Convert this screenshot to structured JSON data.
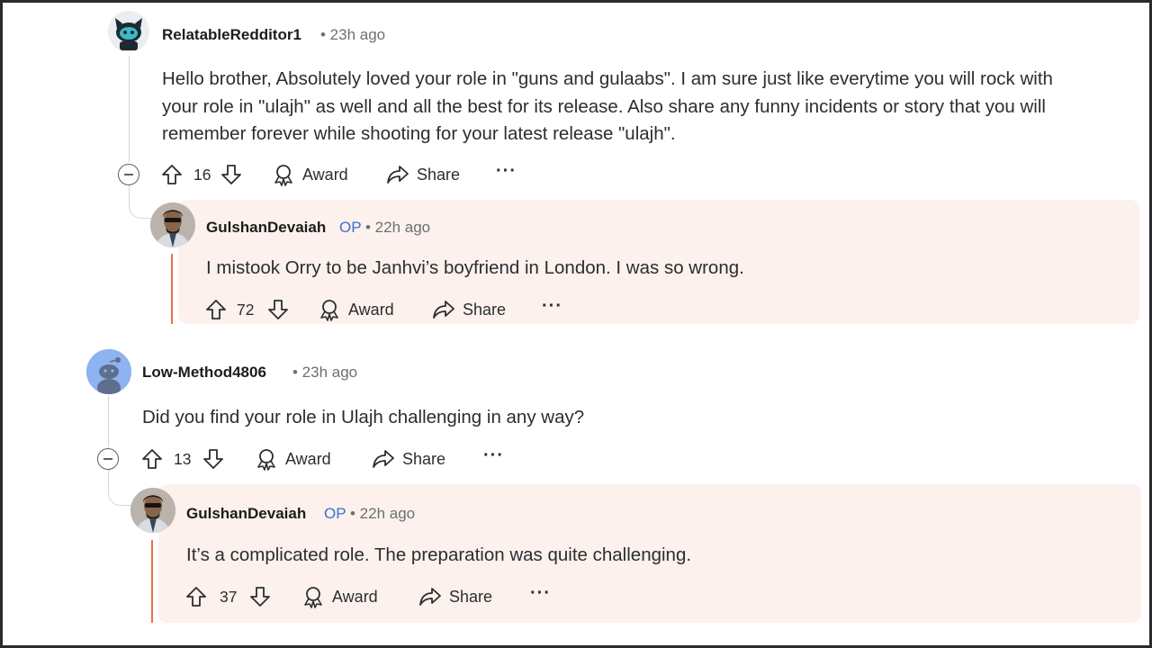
{
  "comments": [
    {
      "author": "RelatableRedditor1",
      "time": "• 23h ago",
      "body_lines": [
        "Hello brother, Absolutely loved your role in \"guns and gulaabs\". I am sure just like everytime you will rock with",
        "your role in \"ulajh\" as well and all the best for its release.  Also share any funny incidents or story that you will",
        "remember forever while shooting for your latest release \"ulajh\"."
      ],
      "votes": "16",
      "award_label": "Award",
      "share_label": "Share",
      "more": "···",
      "reply": {
        "author": "GulshanDevaiah",
        "op_badge": "OP",
        "time": "• 22h ago",
        "body": "I mistook Orry to be Janhvi’s boyfriend in London. I was so wrong.",
        "votes": "72",
        "award_label": "Award",
        "share_label": "Share",
        "more": "···"
      }
    },
    {
      "author": "Low-Method4806",
      "time": "• 23h ago",
      "body": "Did you find your role in Ulajh challenging in any way?",
      "votes": "13",
      "award_label": "Award",
      "share_label": "Share",
      "more": "···",
      "reply": {
        "author": "GulshanDevaiah",
        "op_badge": "OP",
        "time": "• 22h ago",
        "body": "It’s a complicated role. The preparation was quite challenging.",
        "votes": "37",
        "award_label": "Award",
        "share_label": "Share",
        "more": "···"
      }
    }
  ],
  "colors": {
    "op_blue": "#3b6ed8",
    "reply_bg": "#fcf1ec",
    "op_thread": "#e8704a",
    "meta_gray": "#6b7074"
  },
  "icons": [
    "snoo-avatar-icon",
    "upvote-icon",
    "downvote-icon",
    "award-icon",
    "share-icon",
    "more-icon",
    "collapse-icon"
  ]
}
